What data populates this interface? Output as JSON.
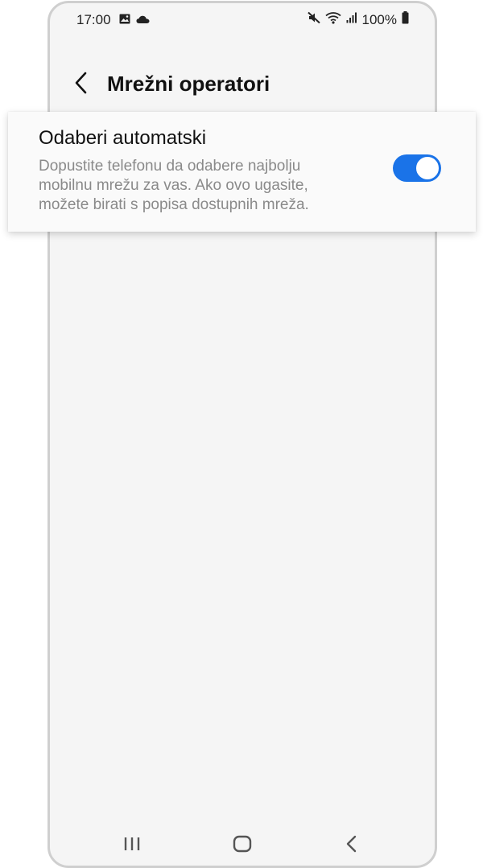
{
  "status_bar": {
    "time": "17:00",
    "battery_text": "100%",
    "left_icons": [
      "gallery-icon",
      "cloud-icon"
    ],
    "right_icons": [
      "mute-icon",
      "wifi-icon",
      "signal-icon",
      "battery-icon"
    ]
  },
  "header": {
    "back_icon": "chevron-left-icon",
    "title": "Mrežni operatori"
  },
  "setting": {
    "title": "Odaberi automatski",
    "description": "Dopustite telefonu da odabere najbolju mobilnu mrežu za vas. Ako ovo ugasite, možete birati s popisa dostupnih mreža.",
    "toggle_state": "on"
  },
  "colors": {
    "accent": "#1a73e8",
    "background": "#f5f5f5",
    "card": "#fafafa",
    "frame": "#cfcfcf",
    "description_text": "#8a8a8a"
  },
  "nav_bar": {
    "items": [
      "recents-icon",
      "home-icon",
      "back-icon"
    ]
  }
}
